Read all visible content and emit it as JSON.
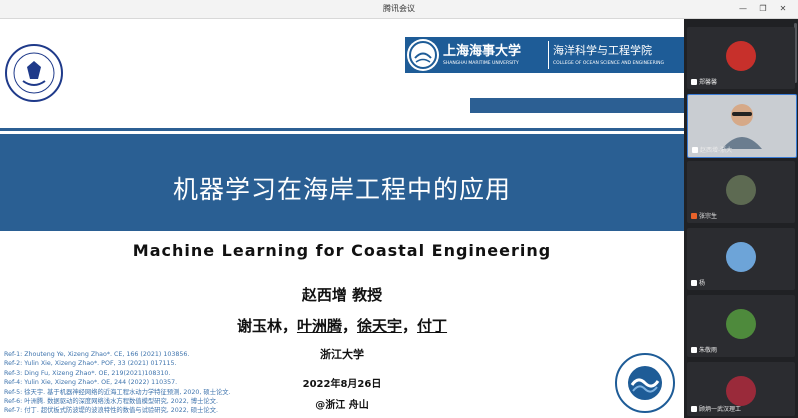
{
  "window": {
    "title": "腾讯会议"
  },
  "slide": {
    "zju_logo_text": "浙江大学 ZHEJIANG UNIVERSITY 1897",
    "smu": {
      "name": "上海海事大学",
      "name_en": "SHANGHAI MARITIME UNIVERSITY",
      "college": "海洋科学与工程学院",
      "college_en": "COLLEGE OF OCEAN SCIENCE AND ENGINEERING"
    },
    "title_cn": "机器学习在海岸工程中的应用",
    "title_en": "Machine Learning for Coastal Engineering",
    "author": "赵西增 教授",
    "coauthors": [
      "谢玉林",
      "叶洲腾",
      "徐天宇",
      "付丁"
    ],
    "coauthor_sep": "，",
    "university": "浙江大学",
    "date": "2022年8月26日",
    "place": "@浙江 舟山",
    "refs": [
      "Ref-1: Zhouteng Ye, Xizeng Zhao*. CE, 166 (2021) 103856.",
      "Ref-2: Yulin Xie, Xizeng Zhao*. POF, 33 (2021) 017115.",
      "Ref-3: Ding Fu, Xizeng Zhao*. OE, 219(2021)108310.",
      "Ref-4: Yulin Xie, Xizeng Zhao*. OE, 244 (2022) 110357.",
      "Ref-5: 徐天宇. 基于机器神经网络的近海工程水动力学特征预测, 2020, 硕士论文.",
      "Ref-6: 叶洲腾. 数据驱动的深度网络浅水方程数值模型研究, 2022, 博士论文.",
      "Ref-7: 付丁. 超伏板式防波堤的波浪特性的数值与试验研究, 2022, 硕士论文."
    ],
    "seal_text": "浙江大学海洋学院"
  },
  "participants": [
    {
      "name": "郑馨馨",
      "avatar_color": "#c7302b",
      "mic": "white"
    },
    {
      "name": "赵西增-浙大",
      "avatar_color": "#c9cdd2",
      "mic": "white",
      "active": true
    },
    {
      "name": "张宗生",
      "avatar_color": "#5d6a52",
      "mic": "orange"
    },
    {
      "name": "杨",
      "avatar_color": "#6da4d8",
      "mic": "white"
    },
    {
      "name": "朱敬雨",
      "avatar_color": "#4e8a3c",
      "mic": "white"
    },
    {
      "name": "顾炳一武汉理工",
      "avatar_color": "#9a2a3a",
      "mic": "white"
    }
  ],
  "colors": {
    "slide_blue": "#2a5f93",
    "smu_blue": "#1e5c97",
    "ref_blue": "#3f74ad",
    "active_border": "#3a7bd5"
  }
}
